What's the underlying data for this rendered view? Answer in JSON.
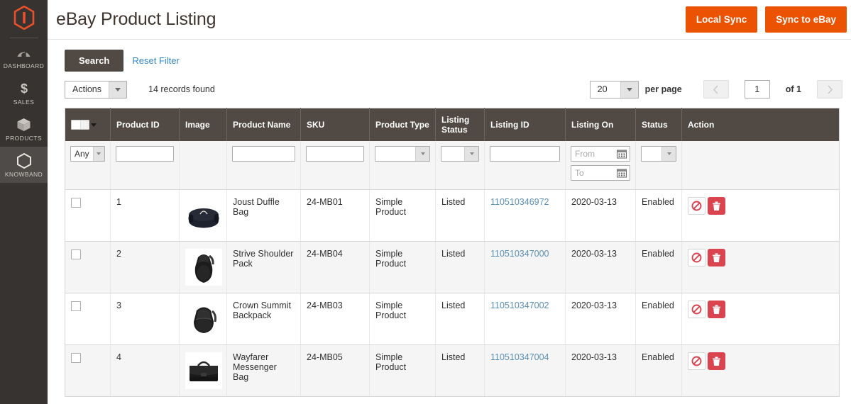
{
  "sidebar": {
    "logo_name": "magento-logo",
    "items": [
      {
        "label": "DASHBOARD",
        "icon": "dashboard-gauge-icon",
        "active": false
      },
      {
        "label": "SALES",
        "icon": "dollar-sign-icon",
        "active": false
      },
      {
        "label": "PRODUCTS",
        "icon": "box-icon",
        "active": false
      },
      {
        "label": "KNOWBAND",
        "icon": "hexagon-icon",
        "active": true
      }
    ]
  },
  "header": {
    "title": "eBay Product Listing",
    "buttons": [
      {
        "label": "Local Sync",
        "name": "local-sync-button"
      },
      {
        "label": "Sync to eBay",
        "name": "sync-to-ebay-button"
      }
    ],
    "accent_color": "#eb5202"
  },
  "toolbar": {
    "search_label": "Search",
    "reset_filter_label": "Reset Filter",
    "actions_label": "Actions",
    "records_found": "14 records found"
  },
  "pagination": {
    "per_page_value": "20",
    "per_page_label": "per page",
    "prev_icon": "chevron-left-icon",
    "next_icon": "chevron-right-icon",
    "current_page": "1",
    "of_label": "of 1"
  },
  "grid": {
    "columns": [
      {
        "label": "",
        "name": "select-all-column"
      },
      {
        "label": "Product ID",
        "name": "product-id-column"
      },
      {
        "label": "Image",
        "name": "image-column"
      },
      {
        "label": "Product Name",
        "name": "product-name-column"
      },
      {
        "label": "SKU",
        "name": "sku-column"
      },
      {
        "label": "Product Type",
        "name": "product-type-column"
      },
      {
        "label": "Listing Status",
        "name": "listing-status-column"
      },
      {
        "label": "Listing ID",
        "name": "listing-id-column"
      },
      {
        "label": "Listing On",
        "name": "listing-on-column"
      },
      {
        "label": "Status",
        "name": "status-column"
      },
      {
        "label": "Action",
        "name": "action-column"
      }
    ],
    "filters": {
      "select_any": "Any",
      "product_id": "",
      "product_name": "",
      "sku": "",
      "product_type": "",
      "listing_status": "",
      "listing_id": "",
      "listing_on_from": "From",
      "listing_on_to": "To",
      "status": ""
    },
    "rows": [
      {
        "product_id": "1",
        "image_icon": "duffle-bag-image",
        "product_name": "Joust Duffle Bag",
        "sku": "24-MB01",
        "product_type": "Simple Product",
        "listing_status": "Listed",
        "listing_id": "110510346972",
        "listing_on": "2020-03-13",
        "status": "Enabled"
      },
      {
        "product_id": "2",
        "image_icon": "shoulder-pack-image",
        "product_name": "Strive Shoulder Pack",
        "sku": "24-MB04",
        "product_type": "Simple Product",
        "listing_status": "Listed",
        "listing_id": "110510347000",
        "listing_on": "2020-03-13",
        "status": "Enabled"
      },
      {
        "product_id": "3",
        "image_icon": "backpack-image",
        "product_name": "Crown Summit Backpack",
        "sku": "24-MB03",
        "product_type": "Simple Product",
        "listing_status": "Listed",
        "listing_id": "110510347002",
        "listing_on": "2020-03-13",
        "status": "Enabled"
      },
      {
        "product_id": "4",
        "image_icon": "messenger-bag-image",
        "product_name": "Wayfarer Messenger Bag",
        "sku": "24-MB05",
        "product_type": "Simple Product",
        "listing_status": "Listed",
        "listing_id": "110510347004",
        "listing_on": "2020-03-13",
        "status": "Enabled"
      }
    ],
    "row_actions": {
      "disable_icon": "prohibited-circle-icon",
      "delete_icon": "trash-icon",
      "delete_color": "#d9444f",
      "disable_color": "#d9444f"
    }
  }
}
